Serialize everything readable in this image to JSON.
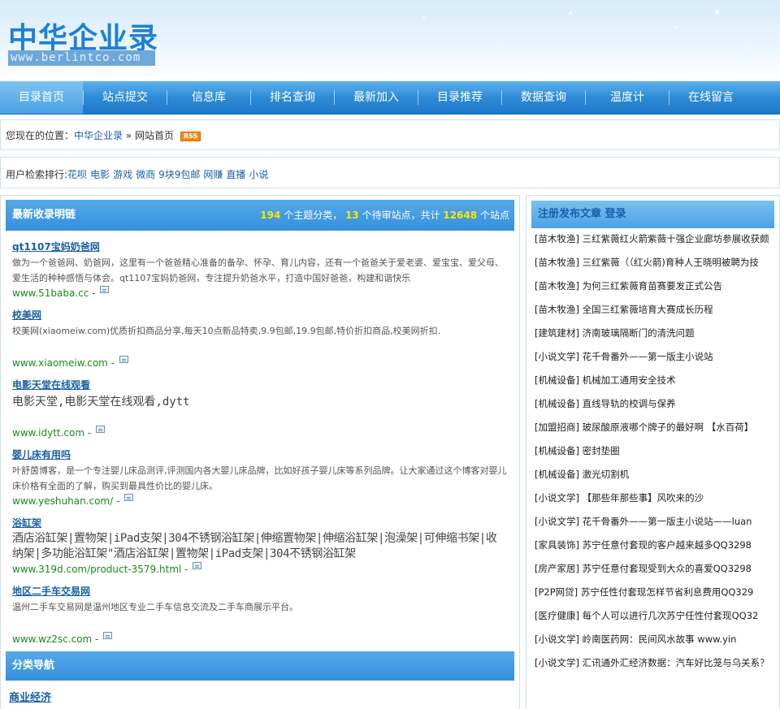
{
  "site": {
    "logo_cn": "中华企业录",
    "logo_en": "www.berlintco.com"
  },
  "nav": [
    {
      "label": "目录首页",
      "active": true
    },
    {
      "label": "站点提交"
    },
    {
      "label": "信息库"
    },
    {
      "label": "排名查询"
    },
    {
      "label": "最新加入"
    },
    {
      "label": "目录推荐"
    },
    {
      "label": "数据查询"
    },
    {
      "label": "温度计"
    },
    {
      "label": "在线留言"
    }
  ],
  "breadcrumb": {
    "prefix": "您现在的位置：",
    "home": "中华企业录",
    "sep": "»",
    "current": "网站首页",
    "rss": "RSS"
  },
  "search_rank": {
    "label": "用户检索排行:",
    "terms": [
      "花呗",
      "电影",
      "游戏",
      "微商",
      "9块9包邮",
      "网赚",
      "直播",
      "小说"
    ]
  },
  "latest": {
    "title": "最新收录明链",
    "stats": {
      "categories": "194",
      "categories_text": "个主题分类，",
      "pending": "13",
      "pending_text": "个待审站点，共计",
      "total": "12648",
      "total_text": "个站点"
    },
    "entries": [
      {
        "title": "qt1107宝妈奶爸网",
        "desc": "做为一个爸爸网、奶爸网，这里有一个爸爸精心准备的备孕、怀孕、育儿内容，还有一个爸爸关于爱老婆、爱宝宝、爱父母、爱生活的种种感悟与体会。qt1107宝妈奶爸网，专注提升奶爸水平，打造中国好爸爸，构建和谐快乐",
        "url": "www.51baba.cc"
      },
      {
        "title": "校美网",
        "desc": "校美网(xiaomeiw.com)优质折扣商品分享,每天10点新品特卖,9.9包邮,19.9包邮,特价折扣商品,校美网折扣.",
        "url": "www.xiaomeiw.com"
      },
      {
        "title": "电影天堂在线观看",
        "desc": "电影天堂,电影天堂在线观看,dytt",
        "url": "www.idytt.com"
      },
      {
        "title": "婴儿床有用吗",
        "desc": "叶舒茵博客，是一个专注婴儿床品测评,评测国内各大婴儿床品牌，比如好孩子婴儿床等系列品牌。让大家通过这个博客对婴儿床价格有全面的了解，购买到最具性价比的婴儿床。",
        "url": "www.yeshuhan.com/"
      },
      {
        "title": "浴缸架",
        "desc": "酒店浴缸架|置物架|iPad支架|304不锈钢浴缸架|伸缩置物架|伸缩浴缸架|泡澡架|可伸缩书架|收纳架|多功能浴缸架\"酒店浴缸架|置物架|iPad支架|304不锈钢浴缸架",
        "url": "www.319d.com/product-3579.html"
      },
      {
        "title": "地区二手车交易网",
        "desc": "温州二手车交易网是温州地区专业二手车信息交流及二手车商展示平台。",
        "url": "www.wz2sc.com"
      }
    ]
  },
  "category_nav": {
    "title": "分类导航",
    "first": "商业经济"
  },
  "articles": {
    "title_register": "注册发布文章",
    "title_login": "登录",
    "items": [
      "[苗木牧渔] 三红紫薇红火箭紫薇十强企业廊坊参展收获颇",
      "[苗木牧渔] 三红紫薇（（红火箭)育种人王晓明被聘为技",
      "[苗木牧渔] 为何三红紫薇育苗赛要发正式公告",
      "[苗木牧渔] 全国三红紫薇培育大赛成长历程",
      "[建筑建材] 济南玻璃隔断门的清洗问题",
      "[小说文学] 花千骨番外——第一版主小说站",
      "[机械设备] 机械加工通用安全技术",
      "[机械设备] 直线导轨的校调与保养",
      "[加盟招商] 玻尿酸原液哪个牌子的最好啊 【水百荷】",
      "[机械设备] 密封垫圈",
      "[机械设备] 激光切割机",
      "[小说文学] 【那些年那些事】风吹来的沙",
      "[小说文学] 花千骨番外——第一版主小说站——luan",
      "[家具装饰] 苏宁任意付套现的客户越来越多QQ3298",
      "[房产家居] 苏宁任意付套现受到大众的喜爱QQ3298",
      "[P2P网贷] 苏宁任性付套现怎样节省利息费用QQ329",
      "[医疗健康] 每个人可以进行几次苏宁任性付套现QQ32",
      "[小说文学] 岭南医药网：民间风水故事 www.yin",
      "[小说文学] 汇讯通外汇经济数据：汽车好比笼与乌关系？"
    ]
  }
}
